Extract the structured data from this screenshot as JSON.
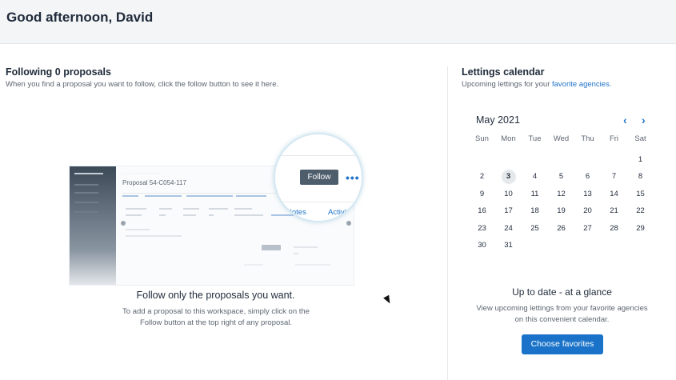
{
  "header": {
    "greeting": "Good afternoon, David"
  },
  "following": {
    "title": "Following 0 proposals",
    "subtitle": "When you find a proposal you want to follow, click the follow button to see it here.",
    "illustration": {
      "proposal_title": "Proposal 54-C054-117",
      "follow_label": "Follow",
      "more_label": "•••",
      "notes_label": "Notes",
      "activity_label": "Activiti"
    },
    "empty_heading": "Follow only the proposals you want.",
    "empty_body": "To add a proposal to this workspace, simply click on the Follow button at the top right of any proposal."
  },
  "calendar": {
    "title": "Lettings calendar",
    "subtitle_prefix": "Upcoming lettings for your ",
    "subtitle_link": "favorite agencies.",
    "month_label": "May 2021",
    "prev_icon": "‹",
    "next_icon": "›",
    "day_headers": [
      "Sun",
      "Mon",
      "Tue",
      "Wed",
      "Thu",
      "Fri",
      "Sat"
    ],
    "weeks": [
      [
        "",
        "",
        "",
        "",
        "",
        "",
        "1"
      ],
      [
        "2",
        "3",
        "4",
        "5",
        "6",
        "7",
        "8"
      ],
      [
        "9",
        "10",
        "11",
        "12",
        "13",
        "14",
        "15"
      ],
      [
        "16",
        "17",
        "18",
        "19",
        "20",
        "21",
        "22"
      ],
      [
        "23",
        "24",
        "25",
        "26",
        "27",
        "28",
        "29"
      ],
      [
        "30",
        "31",
        "",
        "",
        "",
        "",
        ""
      ]
    ],
    "today": "3",
    "glance_title": "Up to date - at a glance",
    "glance_body": "View upcoming lettings from your favorite agencies on this convenient calendar.",
    "choose_button": "Choose favorites"
  }
}
